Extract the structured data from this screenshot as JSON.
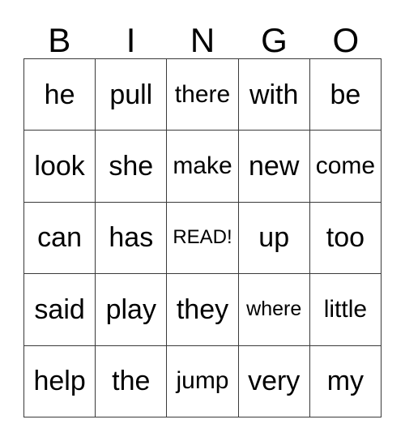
{
  "card": {
    "title_letters": [
      "B",
      "I",
      "N",
      "G",
      "O"
    ],
    "grid": {
      "rows": 5,
      "columns": 5,
      "free_space": {
        "row": 3,
        "column": 3,
        "label": "READ!"
      },
      "cells": [
        [
          "he",
          "pull",
          "there",
          "with",
          "be"
        ],
        [
          "look",
          "she",
          "make",
          "new",
          "come"
        ],
        [
          "can",
          "has",
          "READ!",
          "up",
          "too"
        ],
        [
          "said",
          "play",
          "they",
          "where",
          "little"
        ],
        [
          "help",
          "the",
          "jump",
          "very",
          "my"
        ]
      ]
    },
    "colors": {
      "background": "#ffffff",
      "text": "#000000",
      "grid_line": "#3a3a3a"
    }
  }
}
